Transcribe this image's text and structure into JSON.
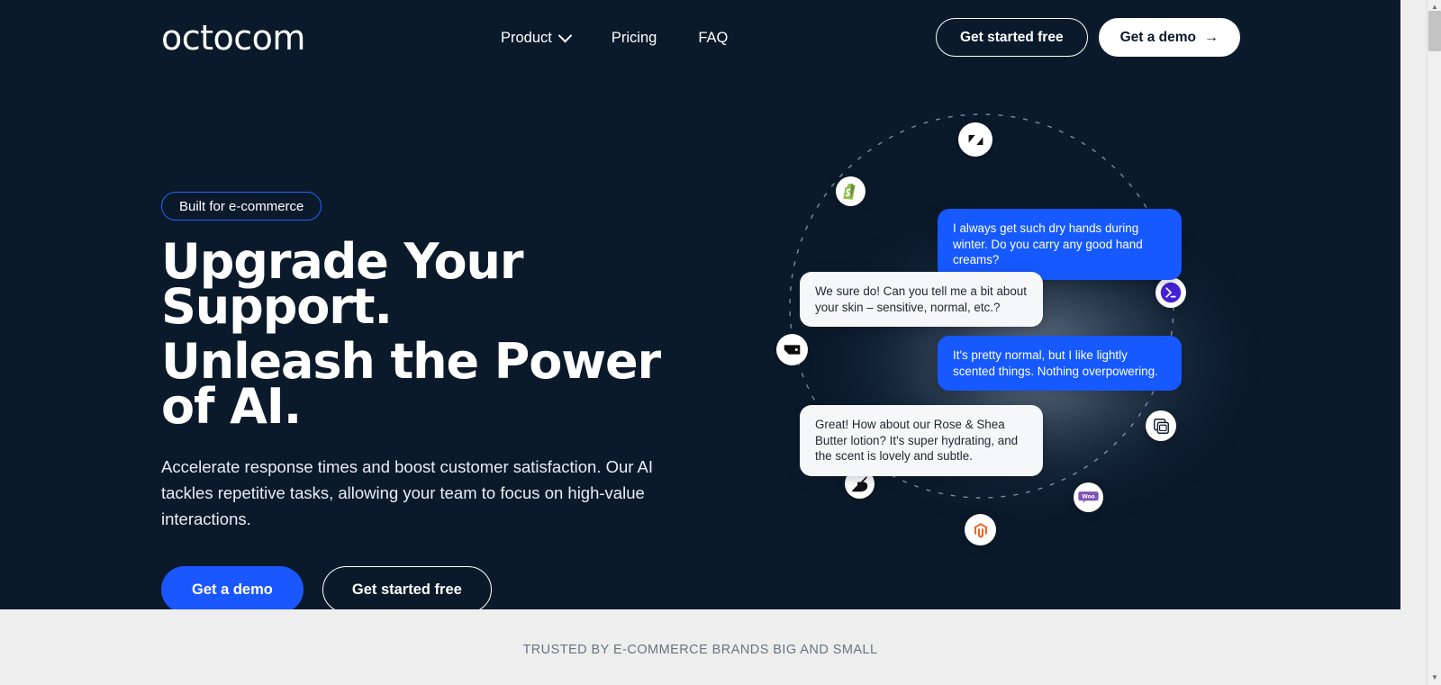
{
  "brand": {
    "logo_text": "octocom",
    "accent_blue": "#1b57ff",
    "panel_bg": "#0b1a2b",
    "band_bg": "#eeeeee"
  },
  "nav": {
    "links": [
      {
        "label": "Product",
        "has_dropdown": true,
        "icon": "chevron-down-icon"
      },
      {
        "label": "Pricing",
        "has_dropdown": false
      },
      {
        "label": "FAQ",
        "has_dropdown": false
      }
    ],
    "cta_secondary": "Get started free",
    "cta_primary": "Get a demo",
    "cta_primary_icon": "arrow-right-icon"
  },
  "hero": {
    "badge": "Built for e-commerce",
    "headline_line1": "Upgrade Your Support.",
    "headline_line2": "Unleash the Power of AI.",
    "subtext": "Accelerate response times and boost customer satisfaction. Our AI tackles repetitive tasks, allowing your team to focus on high-value interactions.",
    "cta_primary": "Get a demo",
    "cta_secondary": "Get started free"
  },
  "conversation": {
    "messages": [
      {
        "role": "user",
        "text": "I always get such dry hands during winter. Do you carry any good hand creams?"
      },
      {
        "role": "bot",
        "text": "We sure do! Can you tell me a bit about your skin – sensitive, normal, etc.?"
      },
      {
        "role": "user",
        "text": "It's pretty normal, but I like lightly scented things. Nothing overpowering."
      },
      {
        "role": "bot",
        "text": "Great! How about our Rose & Shea Butter lotion? It's super hydrating, and the scent is lovely and subtle."
      }
    ]
  },
  "integrations": [
    {
      "name": "zendesk",
      "icon": "zendesk-icon"
    },
    {
      "name": "shopify",
      "icon": "shopify-icon"
    },
    {
      "name": "gorgias",
      "icon": "gorgias-icon"
    },
    {
      "name": "bigcommerce",
      "icon": "bigcommerce-icon"
    },
    {
      "name": "magento",
      "icon": "magento-icon"
    },
    {
      "name": "woocommerce",
      "icon": "woocommerce-icon"
    },
    {
      "name": "front",
      "icon": "front-icon"
    },
    {
      "name": "intercom",
      "icon": "intercom-icon"
    }
  ],
  "trusted": {
    "text": "TRUSTED BY E-COMMERCE BRANDS BIG AND SMALL"
  },
  "scrollbar": {
    "up_glyph": "▲",
    "down_glyph": "▼"
  }
}
